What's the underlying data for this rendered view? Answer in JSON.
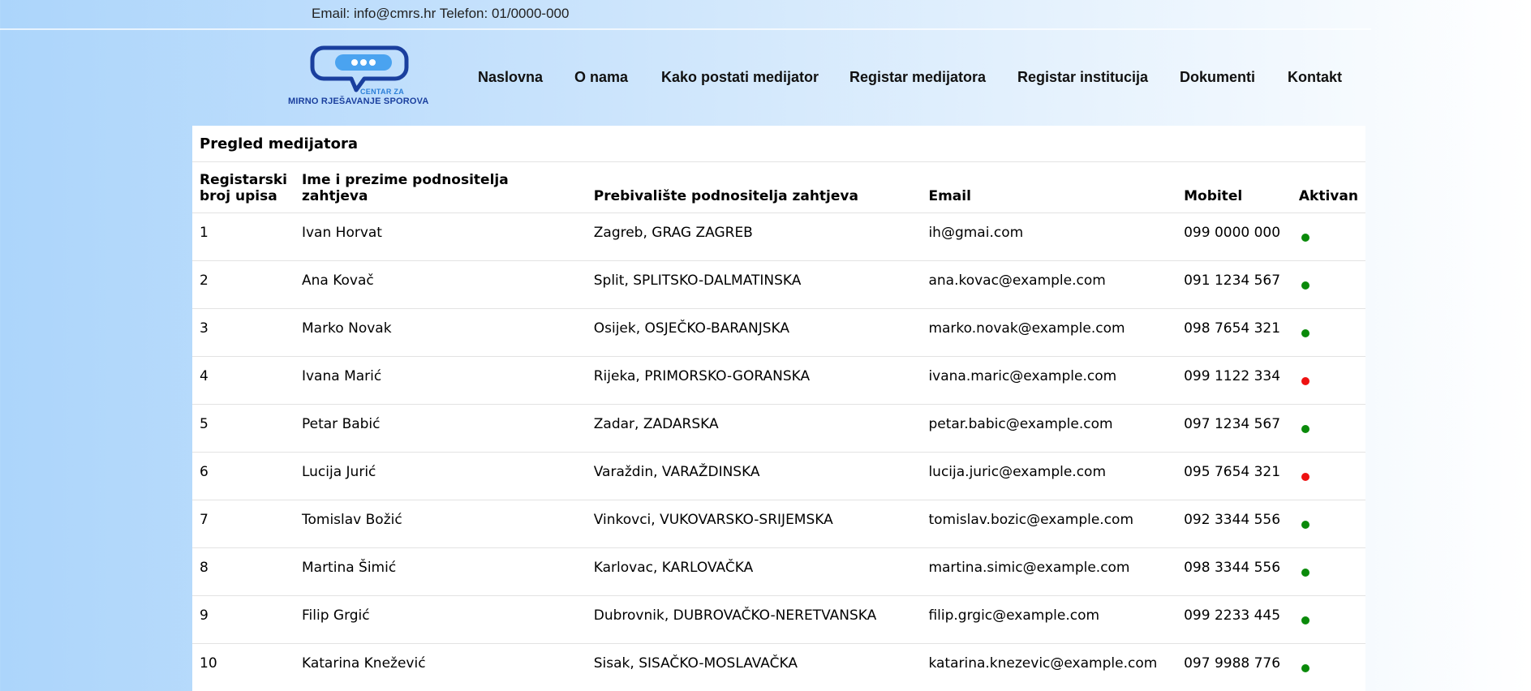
{
  "topbar": {
    "contact": "Email: info@cmrs.hr Telefon: 01/0000-000"
  },
  "logo": {
    "line1": "CENTAR ZA",
    "line2": "MIRNO RJEŠAVANJE SPOROVA",
    "colors": {
      "dark": "#1a3f9e",
      "light": "#4aa3f0"
    }
  },
  "nav": {
    "items": [
      {
        "label": "Naslovna"
      },
      {
        "label": "O nama"
      },
      {
        "label": "Kako postati medijator"
      },
      {
        "label": "Registar medijatora"
      },
      {
        "label": "Registar institucija"
      },
      {
        "label": "Dokumenti"
      },
      {
        "label": "Kontakt"
      }
    ]
  },
  "card": {
    "title": "Pregled medijatora"
  },
  "table": {
    "headers": [
      "Registarski broj upisa",
      "Ime i prezime podnositelja zahtjeva",
      "Prebivalište podnositelja zahtjeva",
      "Email",
      "Mobitel",
      "Aktivan"
    ],
    "status_colors": {
      "active": "#0a8a0a",
      "inactive": "#ee1111"
    },
    "rows": [
      {
        "id": "1",
        "name": "Ivan Horvat",
        "residence": "Zagreb, GRAG ZAGREB",
        "email": "ih@gmai.com",
        "mobile": "099 0000 000",
        "active": true
      },
      {
        "id": "2",
        "name": "Ana Kovač",
        "residence": "Split, SPLITSKO-DALMATINSKA",
        "email": "ana.kovac@example.com",
        "mobile": "091 1234 567",
        "active": true
      },
      {
        "id": "3",
        "name": "Marko Novak",
        "residence": "Osijek, OSJEČKO-BARANJSKA",
        "email": "marko.novak@example.com",
        "mobile": "098 7654 321",
        "active": true
      },
      {
        "id": "4",
        "name": "Ivana Marić",
        "residence": "Rijeka, PRIMORSKO-GORANSKA",
        "email": "ivana.maric@example.com",
        "mobile": "099 1122 334",
        "active": false
      },
      {
        "id": "5",
        "name": "Petar Babić",
        "residence": "Zadar, ZADARSKA",
        "email": "petar.babic@example.com",
        "mobile": "097 1234 567",
        "active": true
      },
      {
        "id": "6",
        "name": "Lucija Jurić",
        "residence": "Varaždin, VARAŽDINSKA",
        "email": "lucija.juric@example.com",
        "mobile": "095 7654 321",
        "active": false
      },
      {
        "id": "7",
        "name": "Tomislav Božić",
        "residence": "Vinkovci, VUKOVARSKO-SRIJEMSKA",
        "email": "tomislav.bozic@example.com",
        "mobile": "092 3344 556",
        "active": true
      },
      {
        "id": "8",
        "name": "Martina Šimić",
        "residence": "Karlovac, KARLOVAČKA",
        "email": "martina.simic@example.com",
        "mobile": "098 3344 556",
        "active": true
      },
      {
        "id": "9",
        "name": "Filip Grgić",
        "residence": "Dubrovnik, DUBROVAČKO-NERETVANSKA",
        "email": "filip.grgic@example.com",
        "mobile": "099 2233 445",
        "active": true
      },
      {
        "id": "10",
        "name": "Katarina Knežević",
        "residence": "Sisak, SISAČKO-MOSLAVAČKA",
        "email": "katarina.knezevic@example.com",
        "mobile": "097 9988 776",
        "active": true
      }
    ]
  }
}
